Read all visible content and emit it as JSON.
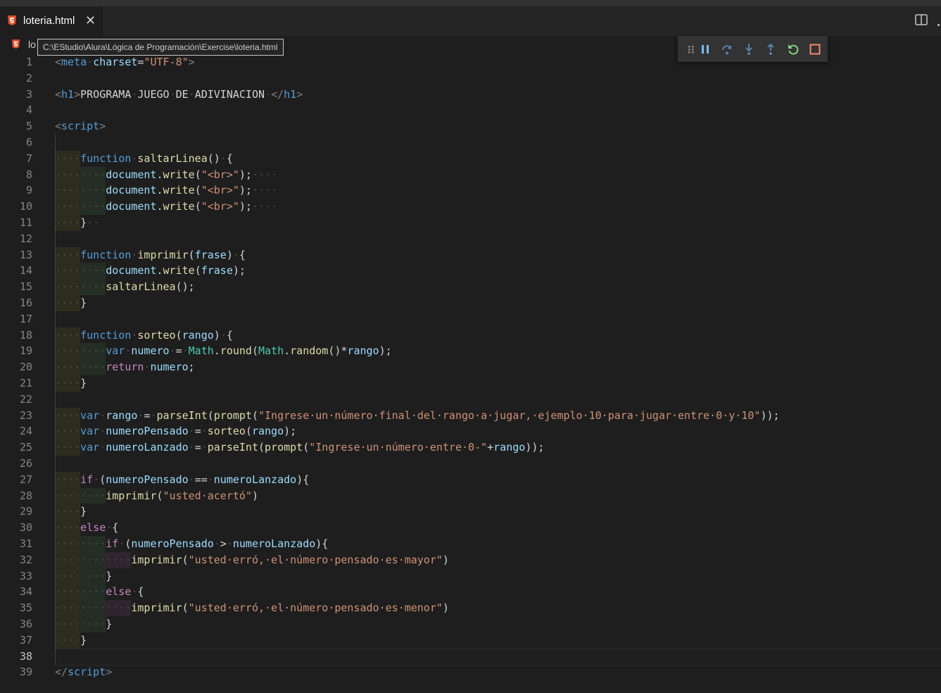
{
  "tab": {
    "label": "loteria.html",
    "close": "✕"
  },
  "breadcrumb": {
    "text": "lo"
  },
  "tooltip": {
    "path": "C:\\EStudio\\Alura\\Lógica de Programación\\Exercise\\loteria.html"
  },
  "debug_toolbar": [
    "drag-handle",
    "pause",
    "step-over",
    "step-into",
    "step-out",
    "restart",
    "stop"
  ],
  "editor": {
    "active_line": 38,
    "lines": [
      {
        "n": "1",
        "parts": [
          [
            "tg",
            "<"
          ],
          [
            "tn",
            "meta"
          ],
          [
            "ws",
            "·"
          ],
          [
            "at",
            "charset"
          ],
          [
            "t",
            "="
          ],
          [
            "st",
            "\"UTF-8\""
          ],
          [
            "tg",
            ">"
          ]
        ]
      },
      {
        "n": "2",
        "parts": []
      },
      {
        "n": "3",
        "parts": [
          [
            "tg",
            "<"
          ],
          [
            "tn",
            "h1"
          ],
          [
            "tg",
            ">"
          ],
          [
            "t",
            "PROGRAMA"
          ],
          [
            "ws",
            "·"
          ],
          [
            "t",
            "JUEGO"
          ],
          [
            "ws",
            "·"
          ],
          [
            "t",
            "DE"
          ],
          [
            "ws",
            "·"
          ],
          [
            "t",
            "ADIVINACION"
          ],
          [
            "ws",
            "·"
          ],
          [
            "tg",
            "</"
          ],
          [
            "tn",
            "h1"
          ],
          [
            "tg",
            ">"
          ]
        ]
      },
      {
        "n": "4",
        "parts": []
      },
      {
        "n": "5",
        "parts": [
          [
            "tg",
            "<"
          ],
          [
            "tn",
            "script"
          ],
          [
            "tg",
            ">"
          ]
        ]
      },
      {
        "n": "6",
        "parts": []
      },
      {
        "n": "7",
        "parts": [
          [
            "ws",
            "····"
          ],
          [
            "kw",
            "function"
          ],
          [
            "ws",
            "·"
          ],
          [
            "fn",
            "saltarLinea"
          ],
          [
            "t",
            "()"
          ],
          [
            "ws",
            "·"
          ],
          [
            "t",
            "{"
          ]
        ]
      },
      {
        "n": "8",
        "parts": [
          [
            "ws",
            "········"
          ],
          [
            "vr",
            "document"
          ],
          [
            "t",
            "."
          ],
          [
            "fn",
            "write"
          ],
          [
            "t",
            "("
          ],
          [
            "st",
            "\"<br>\""
          ],
          [
            "t",
            ");"
          ],
          [
            "ws",
            "····"
          ]
        ]
      },
      {
        "n": "9",
        "parts": [
          [
            "ws",
            "········"
          ],
          [
            "vr",
            "document"
          ],
          [
            "t",
            "."
          ],
          [
            "fn",
            "write"
          ],
          [
            "t",
            "("
          ],
          [
            "st",
            "\"<br>\""
          ],
          [
            "t",
            ");"
          ],
          [
            "ws",
            "····"
          ]
        ]
      },
      {
        "n": "10",
        "parts": [
          [
            "ws",
            "········"
          ],
          [
            "vr",
            "document"
          ],
          [
            "t",
            "."
          ],
          [
            "fn",
            "write"
          ],
          [
            "t",
            "("
          ],
          [
            "st",
            "\"<br>\""
          ],
          [
            "t",
            ");"
          ],
          [
            "ws",
            "····"
          ]
        ]
      },
      {
        "n": "11",
        "parts": [
          [
            "ws",
            "····"
          ],
          [
            "t",
            "}"
          ],
          [
            "ws",
            "··"
          ]
        ]
      },
      {
        "n": "12",
        "parts": []
      },
      {
        "n": "13",
        "parts": [
          [
            "ws",
            "····"
          ],
          [
            "kw",
            "function"
          ],
          [
            "ws",
            "·"
          ],
          [
            "fn",
            "imprimir"
          ],
          [
            "t",
            "("
          ],
          [
            "vr",
            "frase"
          ],
          [
            "t",
            ")"
          ],
          [
            "ws",
            "·"
          ],
          [
            "t",
            "{"
          ]
        ]
      },
      {
        "n": "14",
        "parts": [
          [
            "ws",
            "········"
          ],
          [
            "vr",
            "document"
          ],
          [
            "t",
            "."
          ],
          [
            "fn",
            "write"
          ],
          [
            "t",
            "("
          ],
          [
            "vr",
            "frase"
          ],
          [
            "t",
            ");"
          ]
        ]
      },
      {
        "n": "15",
        "parts": [
          [
            "ws",
            "········"
          ],
          [
            "fn",
            "saltarLinea"
          ],
          [
            "t",
            "();"
          ]
        ]
      },
      {
        "n": "16",
        "parts": [
          [
            "ws",
            "····"
          ],
          [
            "t",
            "}"
          ]
        ]
      },
      {
        "n": "17",
        "parts": []
      },
      {
        "n": "18",
        "parts": [
          [
            "ws",
            "····"
          ],
          [
            "kw",
            "function"
          ],
          [
            "ws",
            "·"
          ],
          [
            "fn",
            "sorteo"
          ],
          [
            "t",
            "("
          ],
          [
            "vr",
            "rango"
          ],
          [
            "t",
            ")"
          ],
          [
            "ws",
            "·"
          ],
          [
            "t",
            "{"
          ]
        ]
      },
      {
        "n": "19",
        "parts": [
          [
            "ws",
            "········"
          ],
          [
            "kw",
            "var"
          ],
          [
            "ws",
            "·"
          ],
          [
            "vr",
            "numero"
          ],
          [
            "ws",
            "·"
          ],
          [
            "t",
            "="
          ],
          [
            "ws",
            "·"
          ],
          [
            "cl",
            "Math"
          ],
          [
            "t",
            "."
          ],
          [
            "fn",
            "round"
          ],
          [
            "t",
            "("
          ],
          [
            "cl",
            "Math"
          ],
          [
            "t",
            "."
          ],
          [
            "fn",
            "random"
          ],
          [
            "t",
            "()*"
          ],
          [
            "vr",
            "rango"
          ],
          [
            "t",
            ");"
          ]
        ]
      },
      {
        "n": "20",
        "parts": [
          [
            "ws",
            "········"
          ],
          [
            "cf",
            "return"
          ],
          [
            "ws",
            "·"
          ],
          [
            "vr",
            "numero"
          ],
          [
            "t",
            ";"
          ]
        ]
      },
      {
        "n": "21",
        "parts": [
          [
            "ws",
            "····"
          ],
          [
            "t",
            "}"
          ]
        ]
      },
      {
        "n": "22",
        "parts": []
      },
      {
        "n": "23",
        "parts": [
          [
            "ws",
            "····"
          ],
          [
            "kw",
            "var"
          ],
          [
            "ws",
            "·"
          ],
          [
            "vr",
            "rango"
          ],
          [
            "ws",
            "·"
          ],
          [
            "t",
            "="
          ],
          [
            "ws",
            "·"
          ],
          [
            "fn",
            "parseInt"
          ],
          [
            "t",
            "("
          ],
          [
            "fn",
            "prompt"
          ],
          [
            "t",
            "("
          ],
          [
            "st",
            "\"Ingrese·un·número·final·del·rango·a·jugar,·ejemplo·10·para·jugar·entre·0·y·10\""
          ],
          [
            "t",
            "));"
          ]
        ]
      },
      {
        "n": "24",
        "parts": [
          [
            "ws",
            "····"
          ],
          [
            "kw",
            "var"
          ],
          [
            "ws",
            "·"
          ],
          [
            "vr",
            "numeroPensado"
          ],
          [
            "ws",
            "·"
          ],
          [
            "t",
            "="
          ],
          [
            "ws",
            "·"
          ],
          [
            "fn",
            "sorteo"
          ],
          [
            "t",
            "("
          ],
          [
            "vr",
            "rango"
          ],
          [
            "t",
            ");"
          ]
        ]
      },
      {
        "n": "25",
        "parts": [
          [
            "ws",
            "····"
          ],
          [
            "kw",
            "var"
          ],
          [
            "ws",
            "·"
          ],
          [
            "vr",
            "numeroLanzado"
          ],
          [
            "ws",
            "·"
          ],
          [
            "t",
            "="
          ],
          [
            "ws",
            "·"
          ],
          [
            "fn",
            "parseInt"
          ],
          [
            "t",
            "("
          ],
          [
            "fn",
            "prompt"
          ],
          [
            "t",
            "("
          ],
          [
            "st",
            "\"Ingrese·un·número·entre·0-\""
          ],
          [
            "t",
            "+"
          ],
          [
            "vr",
            "rango"
          ],
          [
            "t",
            "));"
          ]
        ]
      },
      {
        "n": "26",
        "parts": []
      },
      {
        "n": "27",
        "parts": [
          [
            "ws",
            "····"
          ],
          [
            "cf",
            "if"
          ],
          [
            "ws",
            "·"
          ],
          [
            "t",
            "("
          ],
          [
            "vr",
            "numeroPensado"
          ],
          [
            "ws",
            "·"
          ],
          [
            "t",
            "=="
          ],
          [
            "ws",
            "·"
          ],
          [
            "vr",
            "numeroLanzado"
          ],
          [
            "t",
            "){"
          ]
        ]
      },
      {
        "n": "28",
        "parts": [
          [
            "ws",
            "········"
          ],
          [
            "fn",
            "imprimir"
          ],
          [
            "t",
            "("
          ],
          [
            "st",
            "\"usted·acertó\""
          ],
          [
            "t",
            ")"
          ]
        ]
      },
      {
        "n": "29",
        "parts": [
          [
            "ws",
            "····"
          ],
          [
            "t",
            "}"
          ]
        ]
      },
      {
        "n": "30",
        "parts": [
          [
            "ws",
            "····"
          ],
          [
            "cf",
            "else"
          ],
          [
            "ws",
            "·"
          ],
          [
            "t",
            "{"
          ]
        ]
      },
      {
        "n": "31",
        "parts": [
          [
            "ws",
            "········"
          ],
          [
            "cf",
            "if"
          ],
          [
            "ws",
            "·"
          ],
          [
            "t",
            "("
          ],
          [
            "vr",
            "numeroPensado"
          ],
          [
            "ws",
            "·"
          ],
          [
            "t",
            ">"
          ],
          [
            "ws",
            "·"
          ],
          [
            "vr",
            "numeroLanzado"
          ],
          [
            "t",
            "){"
          ]
        ]
      },
      {
        "n": "32",
        "parts": [
          [
            "ws",
            "············"
          ],
          [
            "fn",
            "imprimir"
          ],
          [
            "t",
            "("
          ],
          [
            "st",
            "\"usted·erró,·el·número·pensado·es·mayor\""
          ],
          [
            "t",
            ")"
          ]
        ]
      },
      {
        "n": "33",
        "parts": [
          [
            "ws",
            "········"
          ],
          [
            "t",
            "}"
          ]
        ]
      },
      {
        "n": "34",
        "parts": [
          [
            "ws",
            "········"
          ],
          [
            "cf",
            "else"
          ],
          [
            "ws",
            "·"
          ],
          [
            "t",
            "{"
          ]
        ]
      },
      {
        "n": "35",
        "parts": [
          [
            "ws",
            "············"
          ],
          [
            "fn",
            "imprimir"
          ],
          [
            "t",
            "("
          ],
          [
            "st",
            "\"usted·erró,·el·número·pensado·es·menor\""
          ],
          [
            "t",
            ")"
          ]
        ]
      },
      {
        "n": "36",
        "parts": [
          [
            "ws",
            "········"
          ],
          [
            "t",
            "}"
          ]
        ]
      },
      {
        "n": "37",
        "parts": [
          [
            "ws",
            "····"
          ],
          [
            "t",
            "}"
          ]
        ]
      },
      {
        "n": "38",
        "parts": []
      },
      {
        "n": "39",
        "parts": [
          [
            "tg",
            "</"
          ],
          [
            "tn",
            "script"
          ],
          [
            "tg",
            ">"
          ]
        ]
      }
    ]
  }
}
